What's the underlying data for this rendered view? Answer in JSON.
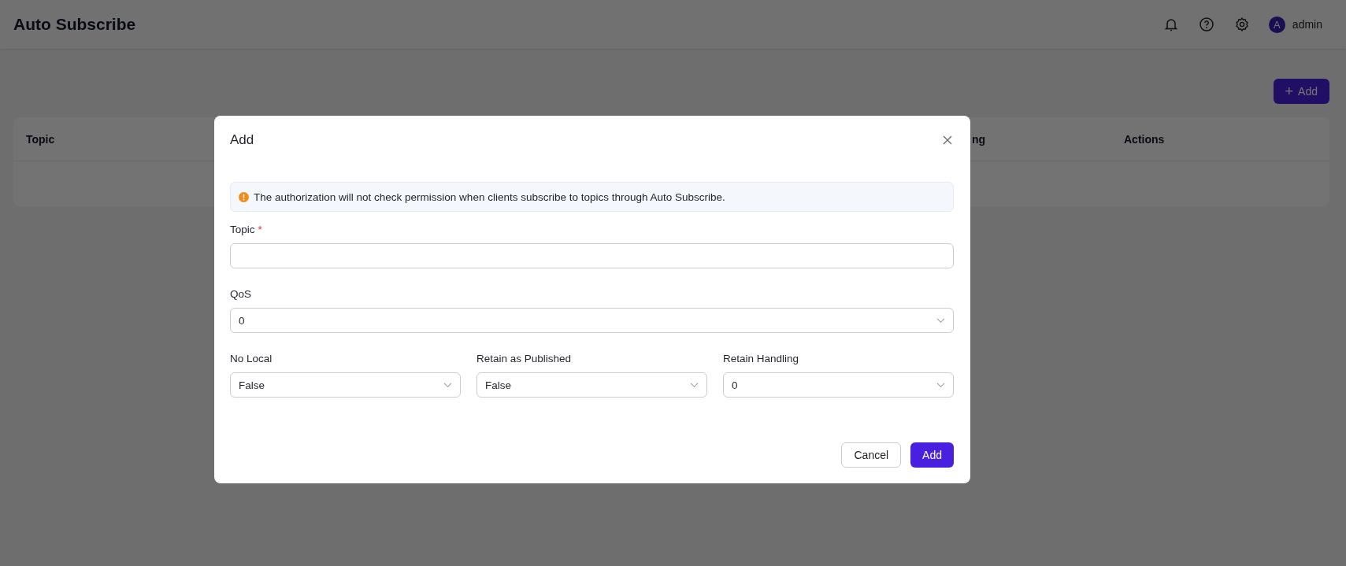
{
  "header": {
    "title": "Auto Subscribe",
    "user": {
      "initial": "A",
      "name": "admin"
    }
  },
  "toolbar": {
    "add_button": {
      "icon": "+",
      "label": "Add"
    }
  },
  "table": {
    "columns": [
      "Topic",
      "ng",
      "Actions"
    ]
  },
  "dialog": {
    "title": "Add",
    "alert": "The authorization will not check permission when clients subscribe to topics through Auto Subscribe.",
    "rows": [
      [
        {
          "label": "Topic",
          "required_mark": "*",
          "kind": "input"
        }
      ],
      [
        {
          "label": "QoS",
          "kind": "select",
          "value": "0"
        }
      ],
      [
        {
          "label": "No Local",
          "kind": "select",
          "value": "False"
        },
        {
          "label": "Retain as Published",
          "kind": "select",
          "value": "False"
        },
        {
          "label": "Retain Handling",
          "kind": "select",
          "value": "0"
        }
      ]
    ],
    "buttons": [
      {
        "label": "Cancel",
        "kind": "secondary"
      },
      {
        "label": "Add",
        "kind": "primary"
      }
    ]
  }
}
